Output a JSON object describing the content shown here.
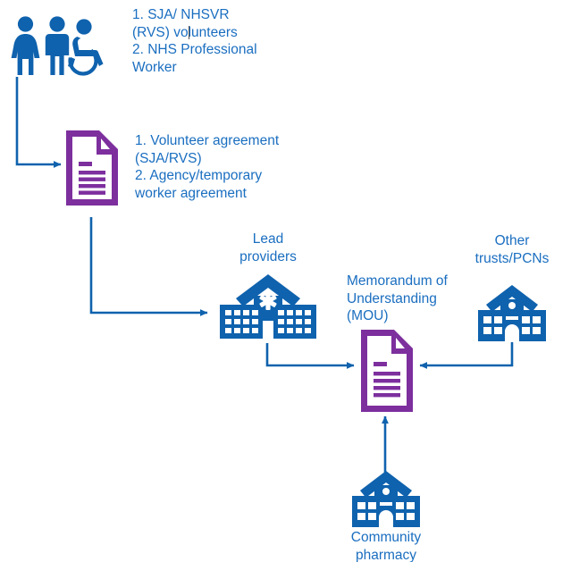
{
  "diagram": {
    "title": "Volunteer and worker agreement flow to Memorandum of Understanding",
    "colors": {
      "blue": "#0f62ad",
      "text_blue": "#1a6ec0",
      "purple": "#7d2f9e",
      "white": "#ffffff",
      "background": "#ffffff"
    }
  },
  "nodes": {
    "people": {
      "icon": "people-group-icon",
      "label": "1. SJA/ NHSVR\n(RVS) volunteers\n2. NHS Professional\nWorker"
    },
    "agreement_document": {
      "icon": "document-icon",
      "label": "1. Volunteer agreement\n(SJA/RVS)\n2. Agency/temporary\nworker agreement"
    },
    "lead_providers": {
      "icon": "hospital-icon",
      "label": "Lead\nproviders"
    },
    "mou_document": {
      "icon": "document-icon",
      "label": "Memorandum of\nUnderstanding\n(MOU)"
    },
    "other_trusts": {
      "icon": "building-icon",
      "label": "Other\ntrusts/PCNs"
    },
    "community_pharmacy": {
      "icon": "building-icon",
      "label": "Community\npharmacy"
    }
  },
  "connectors": [
    {
      "name": "people-to-agreement",
      "from": "people",
      "to": "agreement_document",
      "style": "elbow-down-right-arrow"
    },
    {
      "name": "agreement-to-lead-providers",
      "from": "agreement_document",
      "to": "lead_providers",
      "style": "elbow-down-right-arrow"
    },
    {
      "name": "lead-providers-to-mou",
      "from": "lead_providers",
      "to": "mou_document",
      "style": "elbow-down-right-arrow"
    },
    {
      "name": "other-trusts-to-mou",
      "from": "other_trusts",
      "to": "mou_document",
      "style": "elbow-down-left-arrow"
    },
    {
      "name": "community-pharmacy-to-mou",
      "from": "community_pharmacy",
      "to": "mou_document",
      "style": "straight-up-arrow"
    }
  ]
}
